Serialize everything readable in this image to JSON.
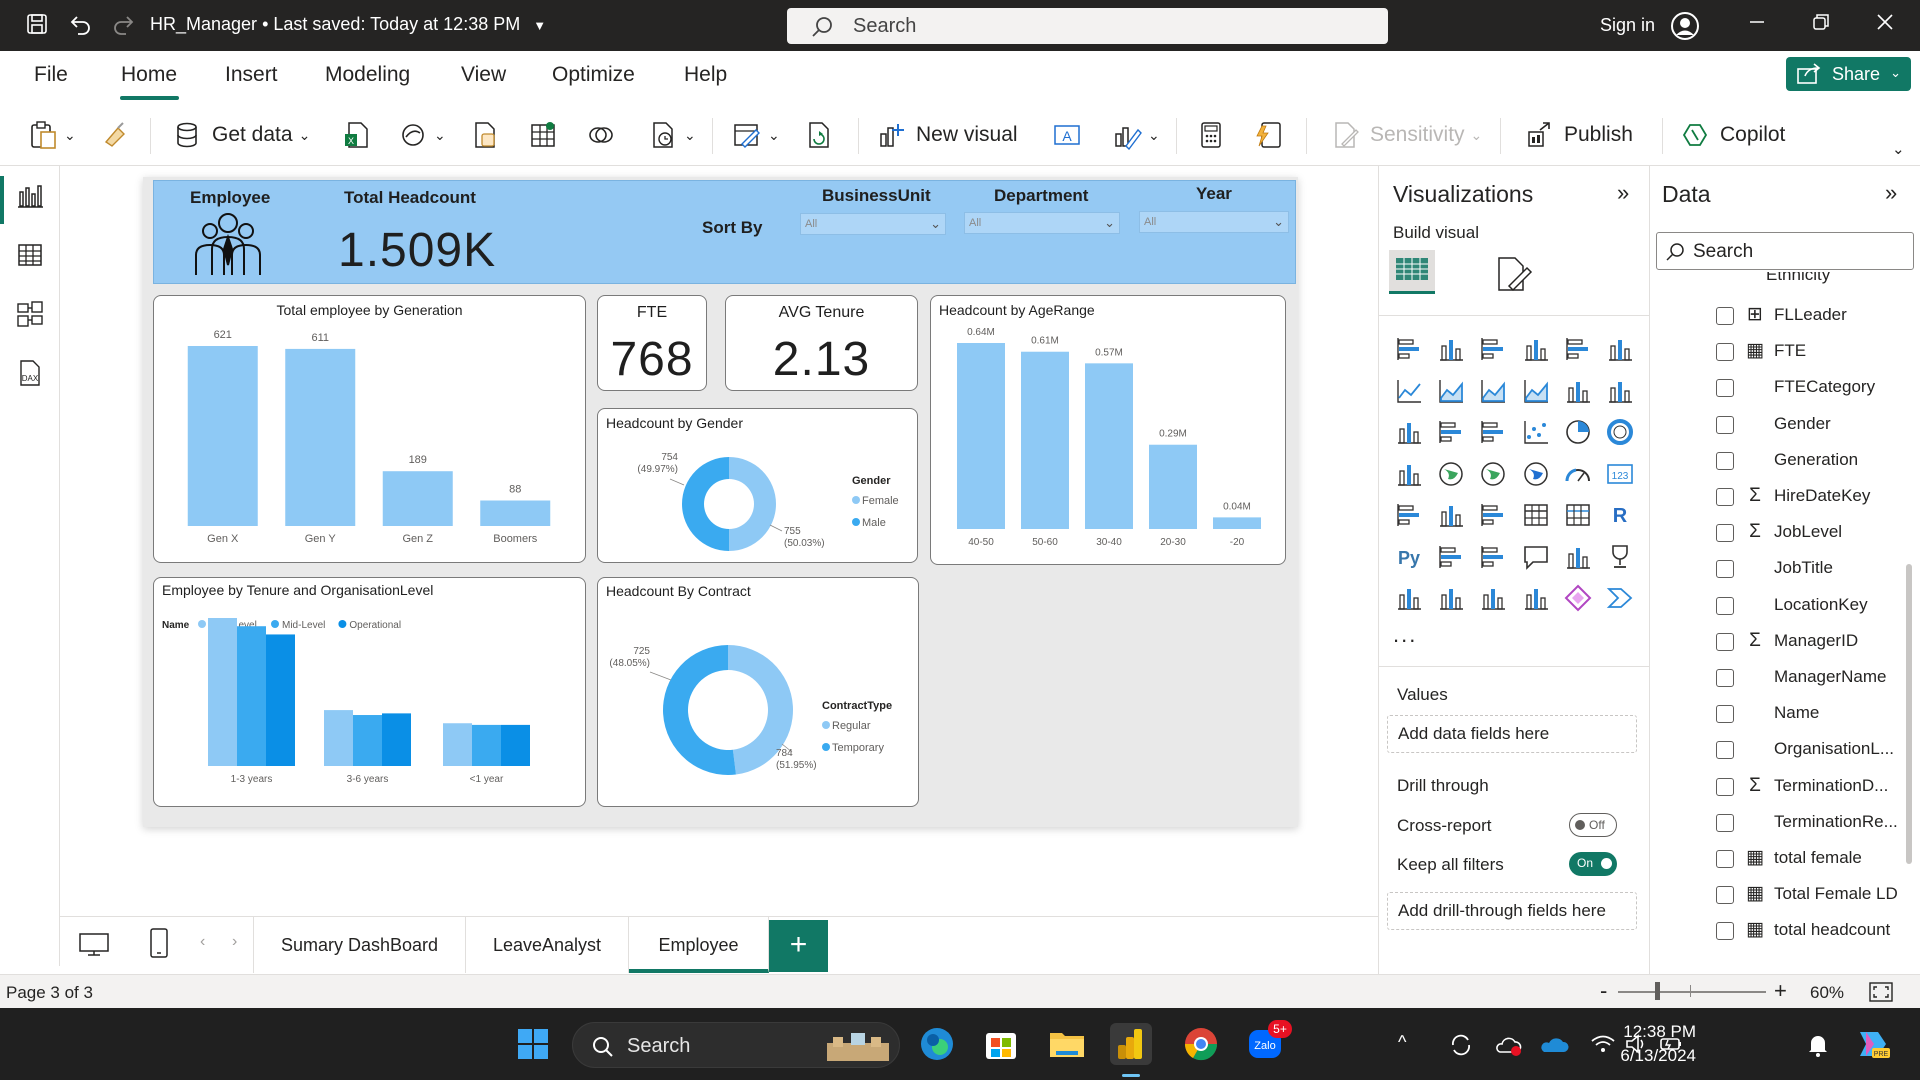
{
  "titlebar": {
    "file_name": "HR_Manager",
    "save_status": "Last saved: Today at 12:38 PM",
    "search_placeholder": "Search",
    "sign_in": "Sign in"
  },
  "menu": {
    "items": [
      "File",
      "Home",
      "Insert",
      "Modeling",
      "View",
      "Optimize",
      "Help"
    ],
    "active": "Home",
    "share_label": "Share"
  },
  "ribbon": {
    "get_data": "Get data",
    "new_visual": "New visual",
    "sensitivity": "Sensitivity",
    "publish": "Publish",
    "copilot": "Copilot"
  },
  "report": {
    "header": {
      "employee_label": "Employee",
      "total_headcount_label": "Total Headcount",
      "total_headcount_value": "1.509K",
      "sort_by": "Sort By",
      "slicers": [
        {
          "label": "BusinessUnit",
          "value": "All"
        },
        {
          "label": "Department",
          "value": "All"
        },
        {
          "label": "Year",
          "value": "All"
        }
      ]
    },
    "kpis": [
      {
        "label": "FTE",
        "value": "768"
      },
      {
        "label": "AVG Tenure",
        "value": "2.13"
      }
    ]
  },
  "chart_data": [
    {
      "id": "generation",
      "type": "bar",
      "title": "Total employee by Generation",
      "categories": [
        "Gen X",
        "Gen Y",
        "Gen Z",
        "Boomers"
      ],
      "values": [
        621,
        611,
        189,
        88
      ],
      "data_labels": [
        "621",
        "611",
        "189",
        "88"
      ],
      "color": "#8ec9f5"
    },
    {
      "id": "agerange",
      "type": "bar",
      "title": "Headcount by AgeRange",
      "categories": [
        "40-50",
        "50-60",
        "30-40",
        "20-30",
        "-20"
      ],
      "values": [
        0.64,
        0.61,
        0.57,
        0.29,
        0.04
      ],
      "data_labels": [
        "0.64M",
        "0.61M",
        "0.57M",
        "0.29M",
        "0.04M"
      ],
      "color": "#8ec9f5"
    },
    {
      "id": "gender",
      "type": "pie",
      "title": "Headcount by Gender",
      "legend_title": "Gender",
      "slices": [
        {
          "name": "Female",
          "value": 754,
          "label": "754",
          "pct": "(49.97%)",
          "color": "#8ec9f5"
        },
        {
          "name": "Male",
          "value": 755,
          "label": "755",
          "pct": "(50.03%)",
          "color": "#3aaaf0"
        }
      ]
    },
    {
      "id": "contract",
      "type": "pie",
      "title": "Headcount By Contract",
      "legend_title": "ContractType",
      "slices": [
        {
          "name": "Regular",
          "value": 725,
          "label": "725",
          "pct": "(48.05%)",
          "color": "#8ec9f5"
        },
        {
          "name": "Temporary",
          "value": 784,
          "label": "784",
          "pct": "(51.95%)",
          "color": "#3aaaf0"
        }
      ]
    },
    {
      "id": "tenure",
      "type": "bar",
      "title": "Employee by Tenure and OrganisationLevel",
      "legend_title": "Name",
      "categories": [
        "1-3 years",
        "3-6 years",
        "<1 year"
      ],
      "series": [
        {
          "name": "High-Level",
          "values": [
            0.9,
            0.34,
            0.26
          ],
          "color": "#8ec9f5"
        },
        {
          "name": "Mid-Level",
          "values": [
            0.85,
            0.31,
            0.25
          ],
          "color": "#3aaaf0"
        },
        {
          "name": "Operational",
          "values": [
            0.8,
            0.32,
            0.25
          ],
          "color": "#0a8fe6"
        }
      ]
    }
  ],
  "page_tabs": {
    "tabs": [
      "Sumary DashBoard",
      "LeaveAnalyst",
      "Employee"
    ],
    "active": "Employee",
    "add": "+"
  },
  "viz_pane": {
    "title": "Visualizations",
    "build_visual": "Build visual",
    "more": "...",
    "values_label": "Values",
    "values_placeholder": "Add data fields here",
    "drill_through": "Drill through",
    "cross_report": "Cross-report",
    "cross_report_state": "Off",
    "keep_filters": "Keep all filters",
    "keep_filters_state": "On",
    "drill_placeholder": "Add drill-through fields here"
  },
  "data_pane": {
    "title": "Data",
    "search_placeholder": "Search",
    "partial_top": "Ethnicity",
    "fields": [
      {
        "name": "FLLeader",
        "type": "hierarchy"
      },
      {
        "name": "FTE",
        "type": "measure"
      },
      {
        "name": "FTECategory",
        "type": "text"
      },
      {
        "name": "Gender",
        "type": "text"
      },
      {
        "name": "Generation",
        "type": "text"
      },
      {
        "name": "HireDateKey",
        "type": "sum"
      },
      {
        "name": "JobLevel",
        "type": "sum"
      },
      {
        "name": "JobTitle",
        "type": "text"
      },
      {
        "name": "LocationKey",
        "type": "text"
      },
      {
        "name": "ManagerID",
        "type": "sum"
      },
      {
        "name": "ManagerName",
        "type": "text"
      },
      {
        "name": "Name",
        "type": "text"
      },
      {
        "name": "OrganisationL...",
        "type": "text"
      },
      {
        "name": "TerminationD...",
        "type": "sum"
      },
      {
        "name": "TerminationRe...",
        "type": "text"
      },
      {
        "name": "total female",
        "type": "measure"
      },
      {
        "name": "Total Female LD",
        "type": "measure"
      },
      {
        "name": "total headcount",
        "type": "measure"
      }
    ]
  },
  "statusbar": {
    "page": "Page 3 of 3",
    "zoom": "60%"
  },
  "taskbar": {
    "search": "Search",
    "time": "12:38 PM",
    "date": "6/13/2024",
    "zalo_badge": "5+"
  }
}
